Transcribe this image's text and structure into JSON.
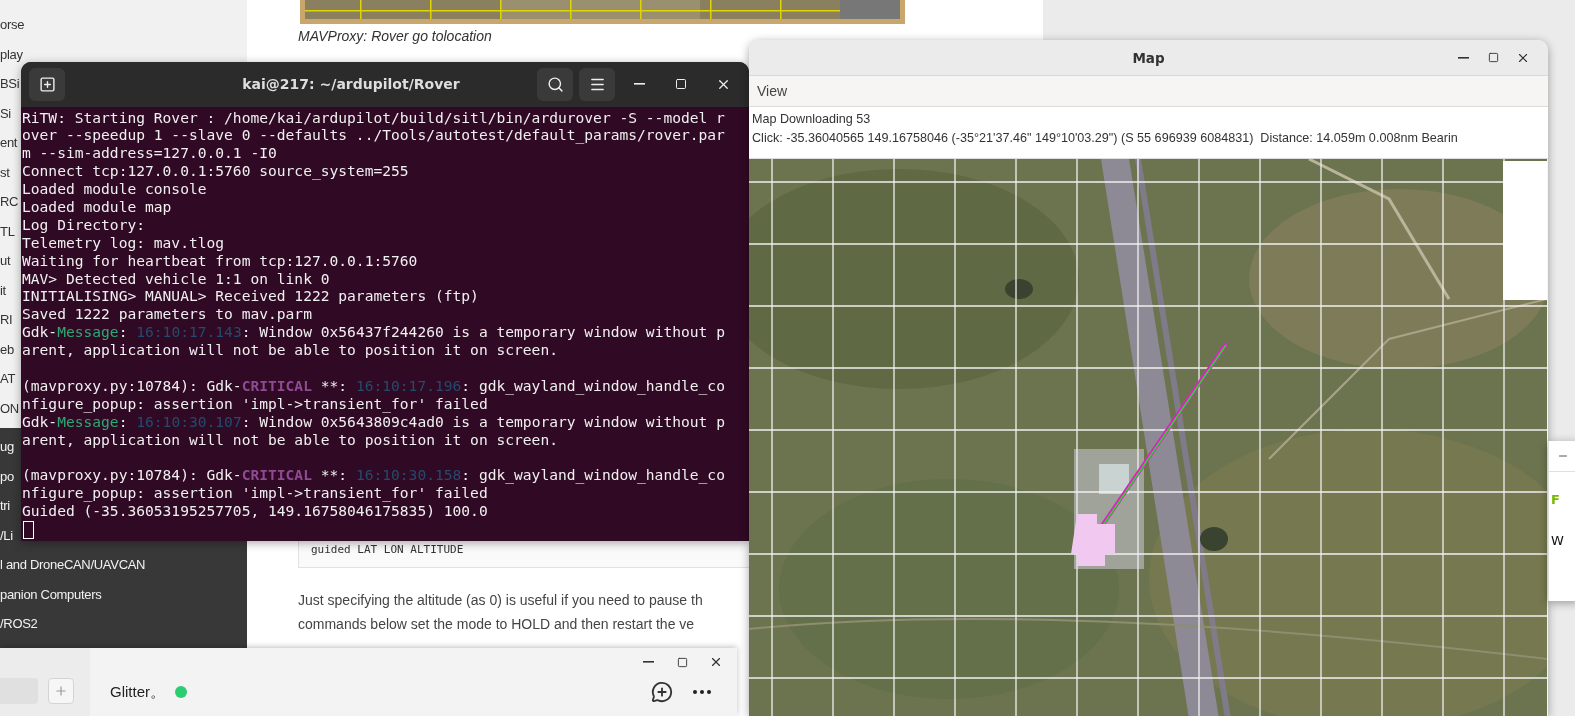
{
  "browser": {
    "figure_caption": "MAVProxy: Rover go tolocation",
    "sidebar": {
      "light_items": [
        "orse",
        "play",
        "BSi",
        "Si",
        "ent",
        "st",
        "RC",
        "TL",
        "ut",
        "it",
        "RI",
        "eb",
        "AT",
        "ON"
      ],
      "dark_items": [
        "ug",
        "po",
        "tri",
        "/Li",
        "l and DroneCAN/UAVCAN",
        "panion Computers",
        "/ROS2"
      ]
    },
    "code_block": "guided LAT LON ALTITUDE",
    "paragraph_lines": [
      "Just specifying the altitude (as 0) is useful if you need to pause th",
      "commands below set the mode to HOLD and then restart the ve"
    ]
  },
  "terminal": {
    "title": "kai@217: ~/ardupilot/Rover",
    "blocks": [
      [
        [
          {
            "kind": "plain",
            "text": "RiTW: Starting Rover : /home/kai/ardupilot/build/sitl/bin/ardurover -S --model r"
          }
        ],
        [
          {
            "kind": "plain",
            "text": "over --speedup 1 --slave 0 --defaults ../Tools/autotest/default_params/rover.par"
          }
        ],
        [
          {
            "kind": "plain",
            "text": "m --sim-address=127.0.0.1 -I0"
          }
        ],
        [
          {
            "kind": "plain",
            "text": "Connect tcp:127.0.0.1:5760 source_system=255"
          }
        ],
        [
          {
            "kind": "plain",
            "text": "Loaded module console"
          }
        ],
        [
          {
            "kind": "plain",
            "text": "Loaded module map"
          }
        ],
        [
          {
            "kind": "plain",
            "text": "Log Directory:"
          }
        ],
        [
          {
            "kind": "plain",
            "text": "Telemetry log: mav.tlog"
          }
        ],
        [
          {
            "kind": "plain",
            "text": "Waiting for heartbeat from tcp:127.0.0.1:5760"
          }
        ],
        [
          {
            "kind": "plain",
            "text": "MAV> Detected vehicle 1:1 on link 0"
          }
        ],
        [
          {
            "kind": "plain",
            "text": "INITIALISING> MANUAL> Received 1222 parameters (ftp)"
          }
        ],
        [
          {
            "kind": "plain",
            "text": "Saved 1222 parameters to mav.parm"
          }
        ],
        [
          {
            "kind": "plain",
            "text": "Gdk-"
          },
          {
            "kind": "message",
            "text": "Message"
          },
          {
            "kind": "plain",
            "text": ": "
          },
          {
            "kind": "time",
            "text": "16:10:17.143"
          },
          {
            "kind": "plain",
            "text": ": Window 0x56437f244260 is a temporary window without p"
          }
        ],
        [
          {
            "kind": "plain",
            "text": "arent, application will not be able to position it on screen."
          }
        ]
      ],
      [
        [
          {
            "kind": "plain",
            "text": "(mavproxy.py:10784): Gdk-"
          },
          {
            "kind": "critical",
            "text": "CRITICAL"
          },
          {
            "kind": "plain",
            "text": " **: "
          },
          {
            "kind": "time",
            "text": "16:10:17.196"
          },
          {
            "kind": "plain",
            "text": ": gdk_wayland_window_handle_co"
          }
        ],
        [
          {
            "kind": "plain",
            "text": "nfigure_popup: assertion 'impl->transient_for' failed"
          }
        ],
        [
          {
            "kind": "plain",
            "text": "Gdk-"
          },
          {
            "kind": "message",
            "text": "Message"
          },
          {
            "kind": "plain",
            "text": ": "
          },
          {
            "kind": "time",
            "text": "16:10:30.107"
          },
          {
            "kind": "plain",
            "text": ": Window 0x5643809c4ad0 is a temporary window without p"
          }
        ],
        [
          {
            "kind": "plain",
            "text": "arent, application will not be able to position it on screen."
          }
        ]
      ],
      [
        [
          {
            "kind": "plain",
            "text": "(mavproxy.py:10784): Gdk-"
          },
          {
            "kind": "critical",
            "text": "CRITICAL"
          },
          {
            "kind": "plain",
            "text": " **: "
          },
          {
            "kind": "time",
            "text": "16:10:30.158"
          },
          {
            "kind": "plain",
            "text": ": gdk_wayland_window_handle_co"
          }
        ],
        [
          {
            "kind": "plain",
            "text": "nfigure_popup: assertion 'impl->transient_for' failed"
          }
        ],
        [
          {
            "kind": "plain",
            "text": "Guided (-35.36053195257705, 149.16758046175835) 100.0"
          }
        ]
      ]
    ]
  },
  "map_window": {
    "title": "Map",
    "menu": [
      "View"
    ],
    "status_lines": [
      "Map Downloading 53",
      "Click: -35.36040565 149.16758046 (-35°21'37.46\" 149°10'03.29\") (S 55 696939 6084831)  Distance: 14.059m 0.008nm Bearin"
    ]
  },
  "chat_window": {
    "name": "Glitter。",
    "online": true
  },
  "side_window": {
    "texts": [
      {
        "kind": "accent",
        "text": "F"
      },
      {
        "kind": "plain",
        "text": "W"
      }
    ]
  }
}
